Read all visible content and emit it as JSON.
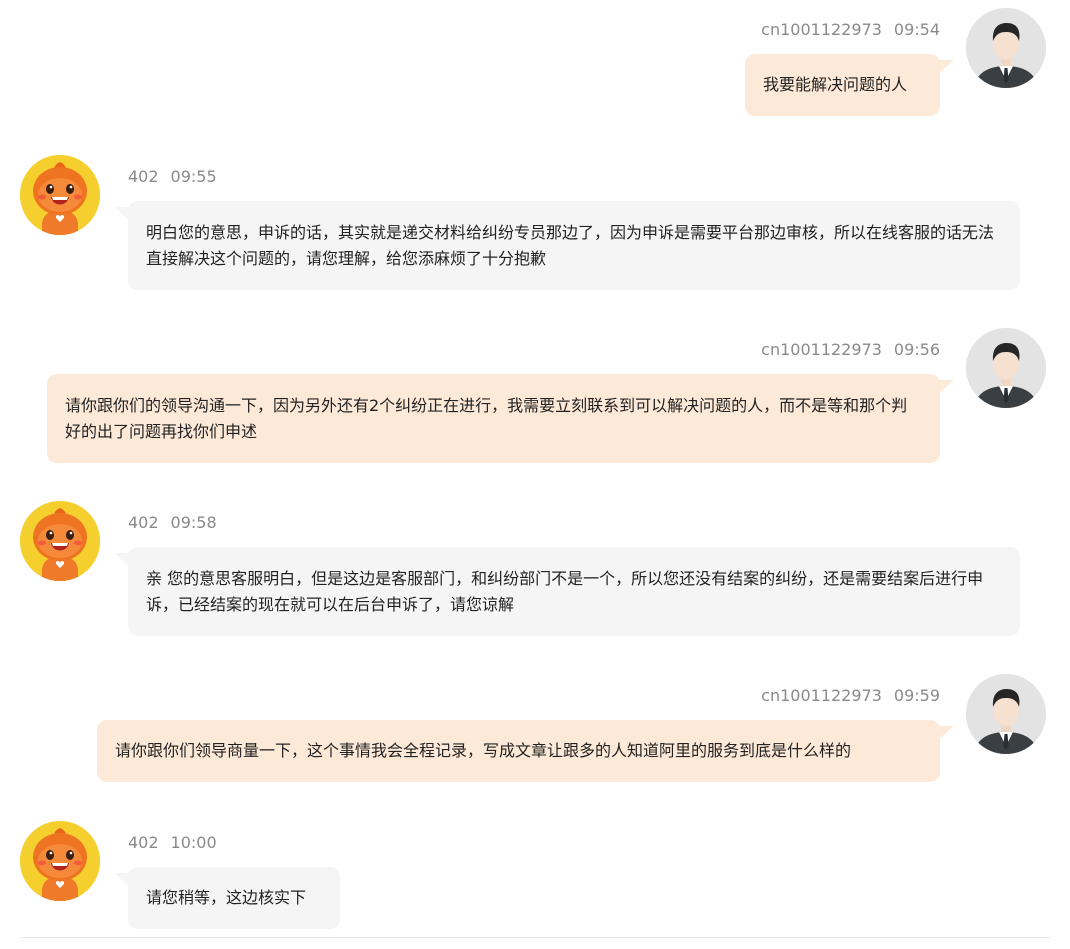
{
  "colors": {
    "outgoing_bubble": "#fce9d7",
    "incoming_bubble": "#f5f5f5",
    "meta_text": "#8a8a8a",
    "bot_avatar_bg": "#f5cf2d"
  },
  "messages": [
    {
      "side": "right",
      "sender": "cn1001122973",
      "time": "09:54",
      "text": "我要能解决问题的人",
      "avatar_icon": "user-businessman-icon"
    },
    {
      "side": "left",
      "sender": "402",
      "time": "09:55",
      "text": "明白您的意思，申诉的话，其实就是递交材料给纠纷专员那边了，因为申诉是需要平台那边审核，所以在线客服的话无法直接解决这个问题的，请您理解，给您添麻烦了十分抱歉",
      "avatar_icon": "mascot-icon"
    },
    {
      "side": "right",
      "sender": "cn1001122973",
      "time": "09:56",
      "text": "请你跟你们的领导沟通一下，因为另外还有2个纠纷正在进行，我需要立刻联系到可以解决问题的人，而不是等和那个判好的出了问题再找你们申述",
      "avatar_icon": "user-businessman-icon"
    },
    {
      "side": "left",
      "sender": "402",
      "time": "09:58",
      "text": "亲 您的意思客服明白，但是这边是客服部门，和纠纷部门不是一个，所以您还没有结案的纠纷，还是需要结案后进行申诉，已经结案的现在就可以在后台申诉了，请您谅解",
      "avatar_icon": "mascot-icon"
    },
    {
      "side": "right",
      "sender": "cn1001122973",
      "time": "09:59",
      "text": "请你跟你们领导商量一下，这个事情我会全程记录，写成文章让跟多的人知道阿里的服务到底是什么样的",
      "avatar_icon": "user-businessman-icon"
    },
    {
      "side": "left",
      "sender": "402",
      "time": "10:00",
      "text": "请您稍等，这边核实下",
      "avatar_icon": "mascot-icon"
    }
  ]
}
